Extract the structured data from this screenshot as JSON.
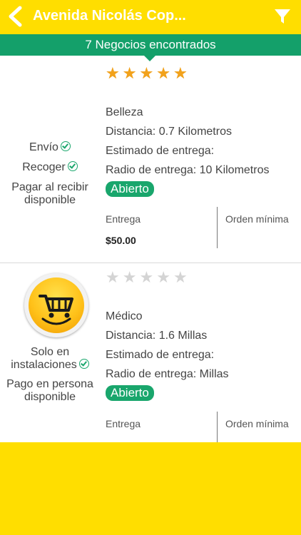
{
  "header": {
    "title": "Avenida Nicolás Cop..."
  },
  "results_banner": {
    "count_text": "7 Negocios encontrados"
  },
  "businesses": [
    {
      "rating": 5,
      "category": "Belleza",
      "distance": "Distancia: 0.7 Kilometros",
      "delivery_estimate": "Estimado de entrega:",
      "delivery_radius": "Radio de entrega: 10 Kilometros",
      "status": "Abierto",
      "options": [
        "Envío",
        "Recoger"
      ],
      "payment": [
        "Pagar al recibir",
        "disponible"
      ],
      "delivery_label": "Entrega",
      "delivery_value": "$50.00",
      "min_order_label": "Orden mínima"
    },
    {
      "rating": 0,
      "category": "Médico",
      "distance": "Distancia: 1.6 Millas",
      "delivery_estimate": "Estimado de entrega:",
      "delivery_radius": "Radio de entrega: Millas",
      "status": "Abierto",
      "options": [
        "Solo en",
        "instalaciones"
      ],
      "payment": [
        "Pago en persona",
        "disponible"
      ],
      "delivery_label": "Entrega",
      "min_order_label": "Orden mínima"
    }
  ],
  "colors": {
    "header": "#FFDE00",
    "banner": "#14A06A",
    "badge": "#19A66C",
    "star": "#F2A21C"
  },
  "icons": {
    "back": "chevron-left-icon",
    "filter": "filter-funnel-icon",
    "cart": "shopping-cart-icon",
    "check": "check-circle-icon"
  }
}
